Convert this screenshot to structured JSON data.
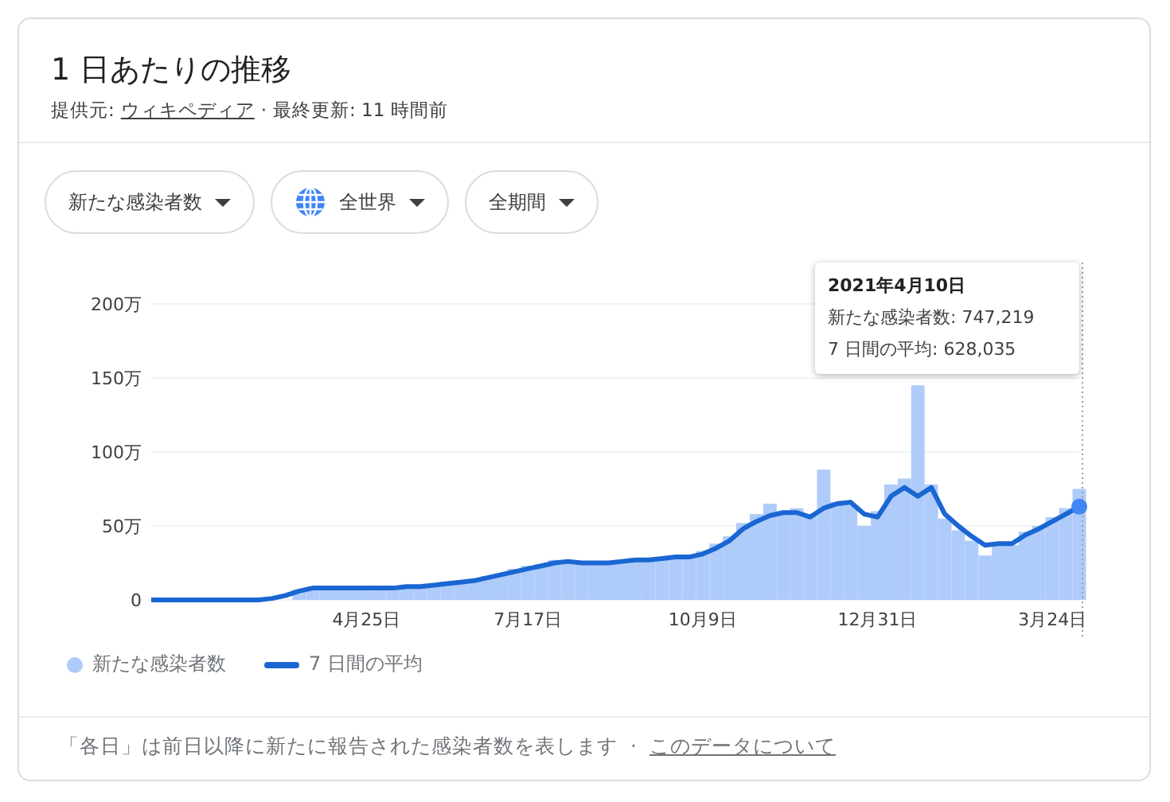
{
  "header": {
    "title": "1 日あたりの推移",
    "source_label": "提供元:",
    "source_link": "ウィキペディア",
    "separator": "·",
    "updated": "最終更新: 11 時間前"
  },
  "filters": [
    {
      "label": "新たな感染者数",
      "kind": "plain"
    },
    {
      "label": "全世界",
      "kind": "region"
    },
    {
      "label": "全期間",
      "kind": "plain"
    }
  ],
  "chart": {
    "chart_data": {
      "type": "bar",
      "grid": true,
      "ylim": [
        0,
        200
      ],
      "yticks": [
        {
          "value": 0,
          "label": "0"
        },
        {
          "value": 50,
          "label": "50万"
        },
        {
          "value": 100,
          "label": "100万"
        },
        {
          "value": 150,
          "label": "150万"
        },
        {
          "value": 200,
          "label": "200万"
        }
      ],
      "categories": [
        null,
        null,
        null,
        null,
        null,
        null,
        null,
        null,
        null,
        null,
        null,
        null,
        null,
        null,
        null,
        null,
        "4月25日",
        null,
        null,
        null,
        null,
        null,
        null,
        null,
        null,
        null,
        null,
        null,
        "7月17日",
        null,
        null,
        null,
        null,
        null,
        null,
        null,
        null,
        null,
        null,
        null,
        null,
        "10月9日",
        null,
        null,
        null,
        null,
        null,
        null,
        null,
        null,
        null,
        null,
        null,
        null,
        "12月31日",
        null,
        null,
        null,
        null,
        null,
        null,
        null,
        null,
        null,
        null,
        null,
        null,
        "3月24日",
        null,
        null
      ],
      "series": [
        {
          "name": "新たな感染者数",
          "type": "bar",
          "color": "#aecbfa",
          "values": [
            0,
            0,
            0,
            0,
            0,
            0,
            0,
            0,
            0,
            null,
            null,
            7,
            8,
            9,
            8,
            8,
            8,
            8,
            9,
            9,
            10,
            11,
            12,
            13,
            14,
            16,
            18,
            21,
            23,
            24,
            27,
            26,
            25,
            26,
            25,
            27,
            27,
            28,
            29,
            30,
            30,
            33,
            38,
            43,
            52,
            58,
            65,
            60,
            62,
            58,
            88,
            66,
            64,
            50,
            60,
            78,
            82,
            145,
            78,
            55,
            47,
            40,
            30,
            39,
            37,
            46,
            50,
            56,
            62,
            75
          ]
        },
        {
          "name": "7 日間の平均",
          "type": "line",
          "color": "#1a66d2",
          "values": [
            0,
            0,
            0,
            0,
            0,
            0,
            0,
            0,
            0,
            1,
            3,
            6,
            8,
            8,
            8,
            8,
            8,
            8,
            8,
            9,
            9,
            10,
            11,
            12,
            13,
            15,
            17,
            19,
            21,
            23,
            25,
            26,
            25,
            25,
            25,
            26,
            27,
            27,
            28,
            29,
            29,
            31,
            35,
            40,
            48,
            53,
            57,
            59,
            59,
            56,
            62,
            65,
            66,
            58,
            56,
            70,
            76,
            70,
            76,
            58,
            50,
            43,
            37,
            38,
            38,
            44,
            48,
            53,
            58,
            63
          ]
        }
      ]
    },
    "tooltip": {
      "date": "2021年4月10日",
      "lines": [
        "新たな感染者数: 747,219",
        "7 日間の平均: 628,035"
      ]
    }
  },
  "footer": {
    "note": "「各日」は前日以降に新たに報告された感染者数を表します",
    "separator": "·",
    "link": "このデータについて"
  }
}
